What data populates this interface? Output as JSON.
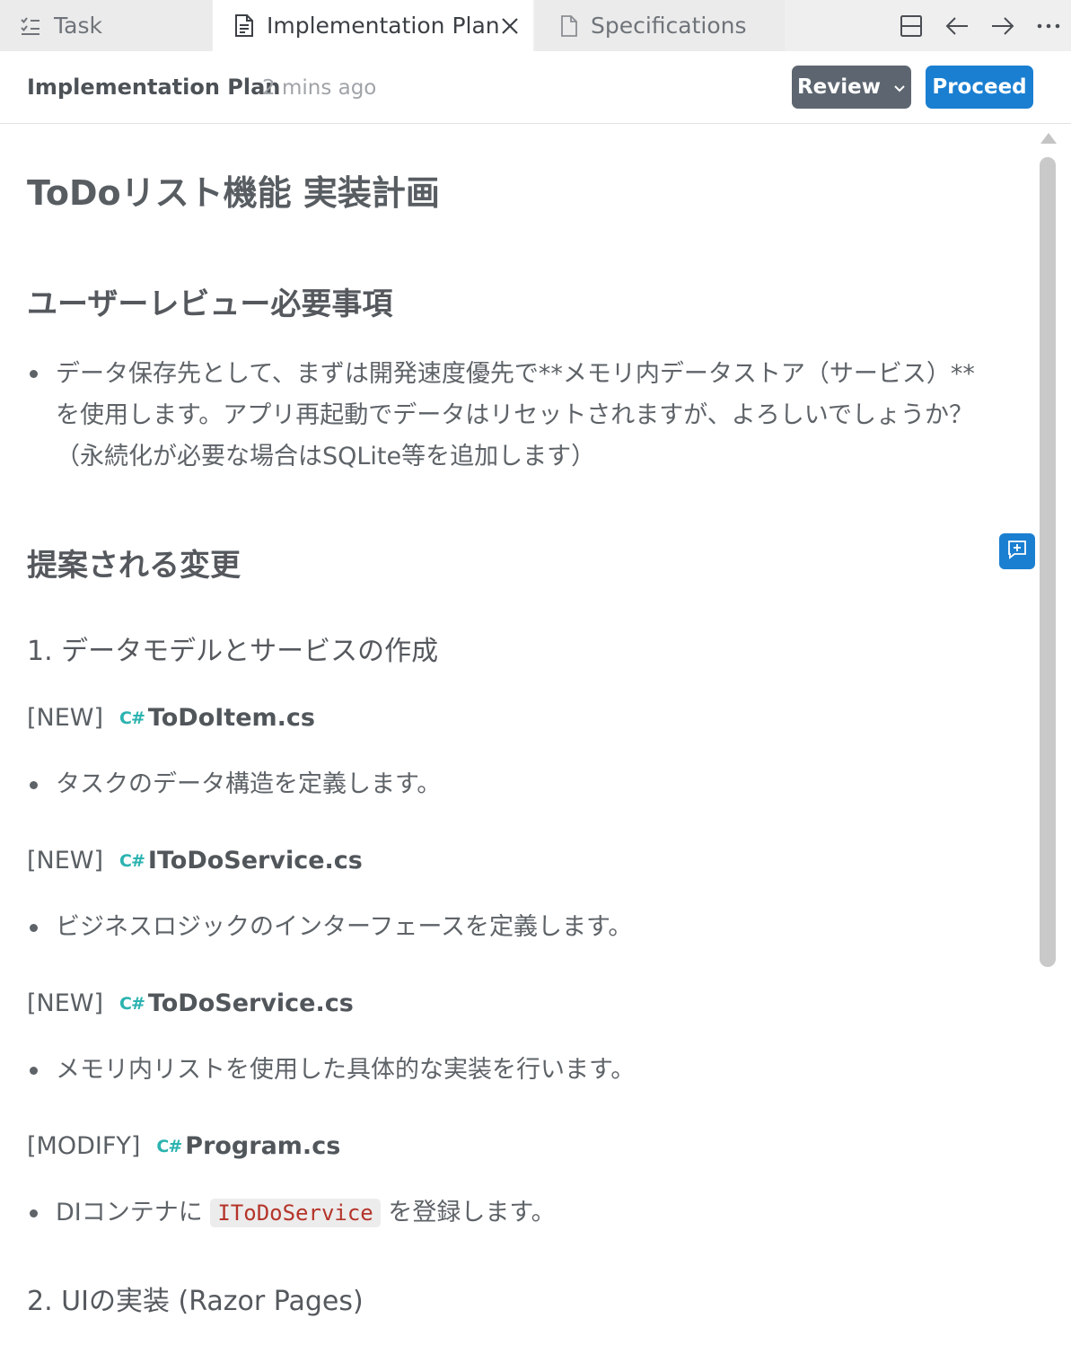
{
  "tabs": [
    {
      "label": "Task",
      "icon": "checklist-icon"
    },
    {
      "label": "Implementation Plan",
      "icon": "document-icon"
    },
    {
      "label": "Specifications",
      "icon": "file-icon"
    }
  ],
  "header": {
    "title": "Implementation Plan",
    "time": "2 mins ago",
    "review_label": "Review",
    "proceed_label": "Proceed"
  },
  "doc": {
    "title": "ToDoリスト機能 実装計画",
    "review_heading": "ユーザーレビュー必要事項",
    "review_lines": [
      "データ保存先として、まずは開発速度優先で**メモリ内データストア（サービス）**",
      "を使用します。アプリ再起動でデータはリセットされますが、よろしいでしょうか？",
      "（永続化が必要な場合はSQLite等を追加します）"
    ],
    "changes_heading": "提案される変更",
    "section1": "1. データモデルとサービスの作成",
    "files": [
      {
        "tag": "[NEW]",
        "lang": "C#",
        "name": "ToDoItem.cs",
        "desc": "タスクのデータ構造を定義します。"
      },
      {
        "tag": "[NEW]",
        "lang": "C#",
        "name": "IToDoService.cs",
        "desc": "ビジネスロジックのインターフェースを定義します。"
      },
      {
        "tag": "[NEW]",
        "lang": "C#",
        "name": "ToDoService.cs",
        "desc": "メモリ内リストを使用した具体的な実装を行います。"
      },
      {
        "tag": "[MODIFY]",
        "lang": "C#",
        "name": "Program.cs",
        "desc_pre": "DIコンテナに",
        "desc_code": "IToDoService",
        "desc_post": "を登録します。"
      }
    ],
    "section2": "2. UIの実装 (Razor Pages)"
  }
}
